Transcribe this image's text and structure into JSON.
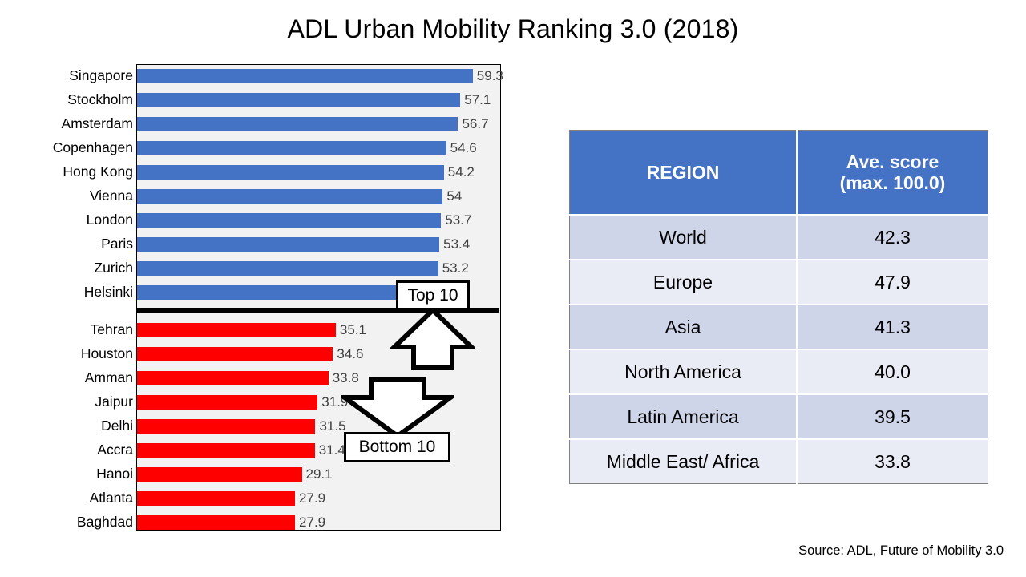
{
  "chart_title": "ADL Urban Mobility Ranking 3.0 (2018)",
  "source_note": "Source: ADL, Future of Mobility 3.0",
  "callouts": {
    "top": {
      "label": "Top 10",
      "arrow_icon": "arrow-up-icon"
    },
    "bottom": {
      "label": "Bottom 10",
      "arrow_icon": "arrow-down-icon"
    }
  },
  "colors": {
    "top10_bar": "#4472C4",
    "bottom10_bar": "#FF0000",
    "plot_background": "#F2F2F2",
    "table_header": "#4472C4",
    "table_row_odd": "#CFD5E8",
    "table_row_even": "#E9ECF5",
    "value_label": "#404040"
  },
  "chart_data": {
    "type": "bar",
    "orientation": "horizontal",
    "title": "ADL Urban Mobility Ranking 3.0 (2018)",
    "xlabel": "",
    "ylabel": "",
    "xlim": [
      0,
      64
    ],
    "grid": false,
    "legend": "none",
    "series": [
      {
        "name": "Top 10",
        "color": "#4472C4",
        "categories": [
          "Singapore",
          "Stockholm",
          "Amsterdam",
          "Copenhagen",
          "Hong Kong",
          "Vienna",
          "London",
          "Paris",
          "Zurich",
          "Helsinki"
        ],
        "values": [
          59.3,
          57.1,
          56.7,
          54.6,
          54.2,
          54.0,
          53.7,
          53.4,
          53.2,
          52.8
        ]
      },
      {
        "name": "Bottom 10",
        "color": "#FF0000",
        "categories": [
          "Tehran",
          "Houston",
          "Amman",
          "Jaipur",
          "Delhi",
          "Accra",
          "Hanoi",
          "Atlanta",
          "Baghdad"
        ],
        "values": [
          35.1,
          34.6,
          33.8,
          31.9,
          31.5,
          31.4,
          29.1,
          27.9,
          27.9
        ]
      }
    ]
  },
  "region_table": {
    "headers": [
      "REGION",
      "Ave. score\n(max. 100.0)"
    ],
    "header_region": "REGION",
    "header_score_line1": "Ave. score",
    "header_score_line2": "(max. 100.0)",
    "rows": [
      {
        "region": "World",
        "score": "42.3"
      },
      {
        "region": "Europe",
        "score": "47.9"
      },
      {
        "region": "Asia",
        "score": "41.3"
      },
      {
        "region": "North America",
        "score": "40.0"
      },
      {
        "region": "Latin America",
        "score": "39.5"
      },
      {
        "region": "Middle East/ Africa",
        "score": "33.8"
      }
    ]
  }
}
